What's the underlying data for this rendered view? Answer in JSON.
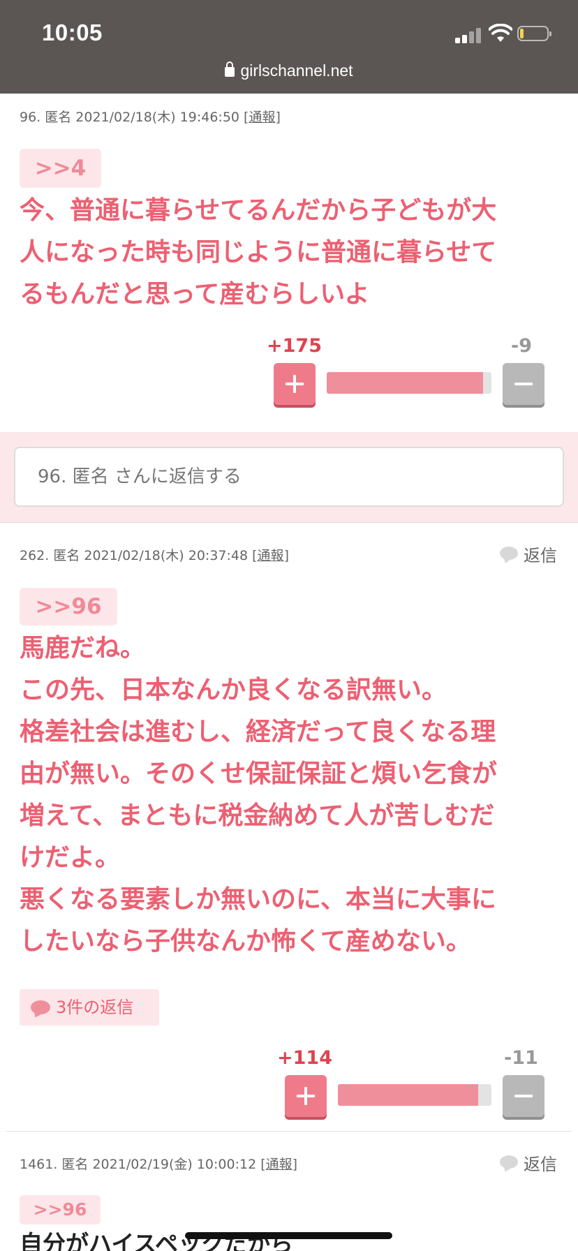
{
  "status_bar": {
    "time": "10:05",
    "url": "girlschannel.net"
  },
  "comments": [
    {
      "meta_prefix": "96. 匿名 2021/02/18(木) 19:46:50 [",
      "report": "通報",
      "meta_suffix": "]",
      "anchor": ">>4",
      "text": "今、普通に暮らせてるんだから子どもが大\n人になった時も同じように普通に暮らせて\nるもんだと思って産むらしいよ",
      "plus": "+175",
      "minus": "-9",
      "plus_ratio": 0.951
    },
    {
      "meta_prefix": "262. 匿名 2021/02/18(木) 20:37:48 [",
      "report": "通報",
      "meta_suffix": "]",
      "reply": "返信",
      "anchor": ">>96",
      "text": "馬鹿だね。\nこの先、日本なんか良くなる訳無い。\n格差社会は進むし、経済だって良くなる理\n由が無い。そのくせ保証保証と煩い乞食が\n増えて、まともに税金納めて人が苦しむだ\nけだよ。\n悪くなる要素しか無いのに、本当に大事に\nしたいなら子供なんか怖くて産めない。",
      "replies_count": "3件の返信",
      "plus": "+114",
      "minus": "-11",
      "plus_ratio": 0.912
    },
    {
      "meta_prefix": "1461. 匿名 2021/02/19(金) 10:00:12 [",
      "report": "通報",
      "meta_suffix": "]",
      "reply": "返信",
      "anchor": ">>96",
      "text": "自分がハイスペックだから"
    }
  ],
  "reply_box": {
    "placeholder": "96. 匿名 さんに返信する"
  },
  "colors": {
    "accent": "#ec6072",
    "plus": "#ef7b8a",
    "bar_fill": "#ef8f9b"
  }
}
